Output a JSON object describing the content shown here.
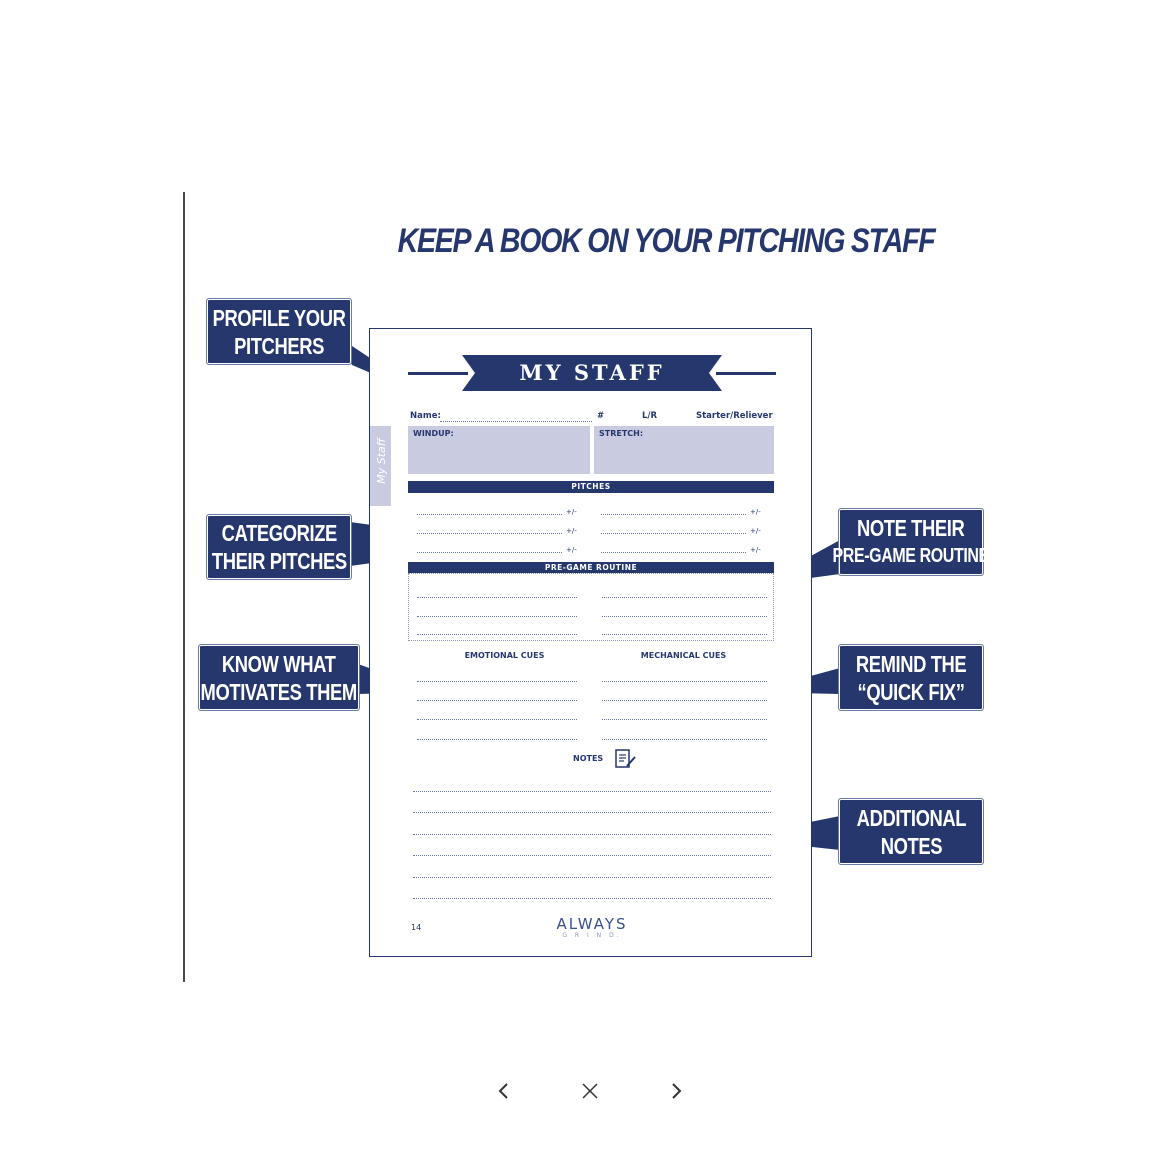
{
  "title": "KEEP A BOOK ON YOUR PITCHING STAFF",
  "callouts": {
    "profile": [
      "PROFILE YOUR",
      "PITCHERS"
    ],
    "categorize": [
      "CATEGORIZE",
      "THEIR PITCHES"
    ],
    "motivates": [
      "KNOW WHAT",
      "MOTIVATES THEM"
    ],
    "pregame": [
      "NOTE THEIR",
      "PRE-GAME ROUTINE"
    ],
    "quickfix": [
      "REMIND THE",
      "“QUICK FIX”"
    ],
    "notes": [
      "ADDITIONAL",
      "NOTES"
    ]
  },
  "sheet": {
    "banner": "MY STAFF",
    "side_tab": "My Staff",
    "fields": {
      "name": "Name:",
      "number": "#",
      "lr": "L/R",
      "role": "Starter/Reliever",
      "windup": "WINDUP:",
      "stretch": "STRETCH:"
    },
    "pitches_header": "PITCHES",
    "plus_minus": "+/-",
    "routine_header": "PRE-GAME ROUTINE",
    "emotional_cues": "EMOTIONAL CUES",
    "mechanical_cues": "MECHANICAL CUES",
    "notes_label": "NOTES",
    "page_number": "14",
    "brand_top": "ALWAYS",
    "brand_bottom": "G R I N D."
  },
  "nav": {
    "prev_icon": "chevron-left-icon",
    "close_icon": "close-icon",
    "next_icon": "chevron-right-icon"
  },
  "colors": {
    "navy": "#26376e",
    "lavender": "#c9cbe1"
  }
}
